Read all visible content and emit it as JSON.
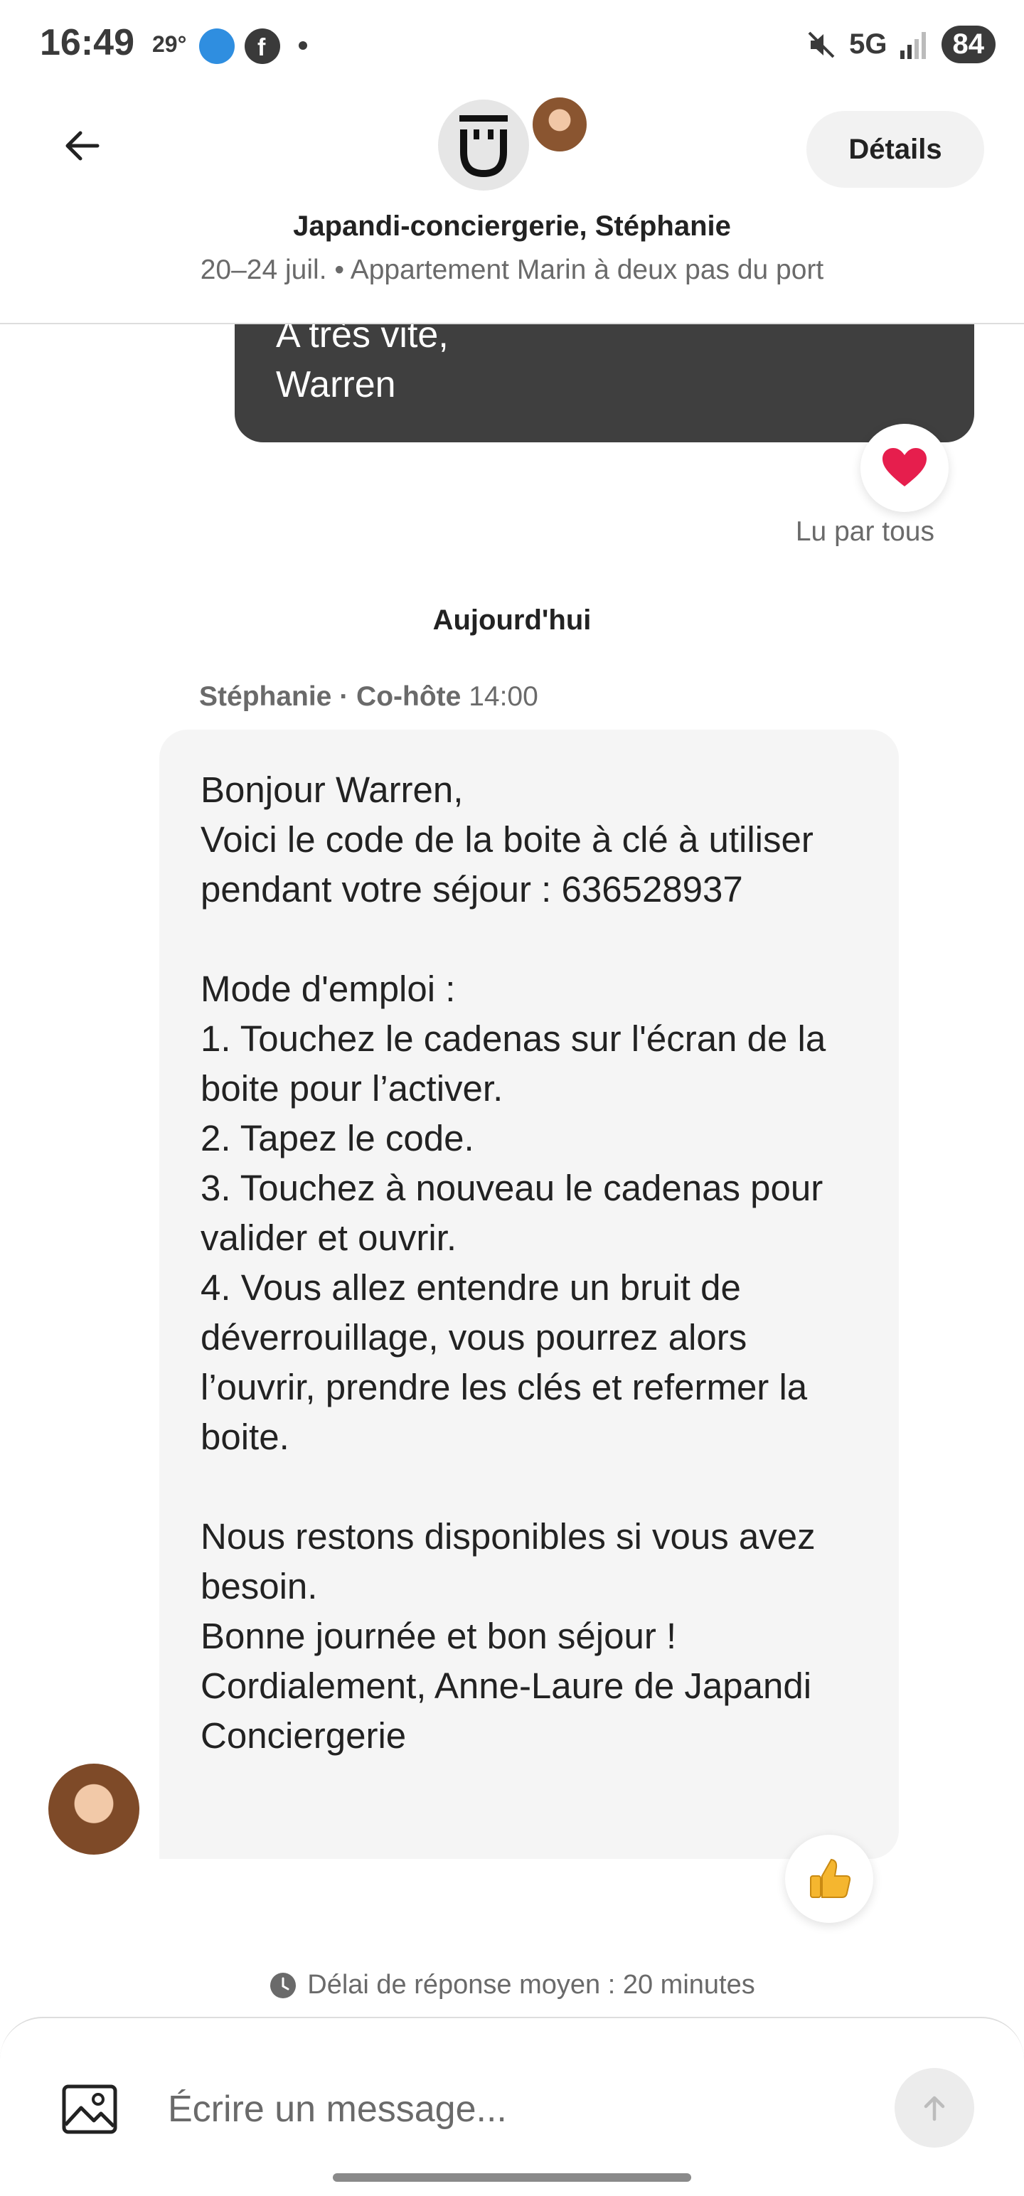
{
  "status_bar": {
    "time": "16:49",
    "temperature": "29°",
    "network": "5G",
    "battery": "84"
  },
  "header": {
    "details_label": "Détails",
    "title": "Japandi-conciergerie, Stéphanie",
    "subtitle": "20–24 juil. • Appartement Marin à deux pas du port"
  },
  "conversation": {
    "sent_message": {
      "text": "A très vite,\nWarren",
      "reaction": "heart-icon",
      "read_status": "Lu par tous"
    },
    "date_separator": "Aujourd'hui",
    "received_message": {
      "sender_name": "Stéphanie",
      "sender_role": "· Co-hôte",
      "time": "14:00",
      "text": "Bonjour Warren,\nVoici le code de la boite à clé à utiliser pendant votre séjour : 636528937\n\nMode d'emploi :\n1. Touchez le cadenas sur l'écran de la boite pour l’activer.\n2. Tapez le code.\n3. Touchez à nouveau le cadenas pour valider et ouvrir.\n4. Vous allez entendre un bruit de déverrouillage, vous pourrez alors l’ouvrir, prendre les clés et refermer la boite.\n\nNous restons disponibles si vous avez besoin.\nBonne journée et bon séjour !\nCordialement, Anne-Laure de Japandi Conciergerie",
      "reaction": "thumbs-up-icon"
    },
    "response_time": "Délai de réponse moyen : 20 minutes"
  },
  "composer": {
    "placeholder": "Écrire un message..."
  },
  "colors": {
    "sent_bubble": "#3f3f3f",
    "received_bubble": "#f5f5f5",
    "heart": "#e61e4d",
    "secondary_text": "#6a6a6a"
  }
}
